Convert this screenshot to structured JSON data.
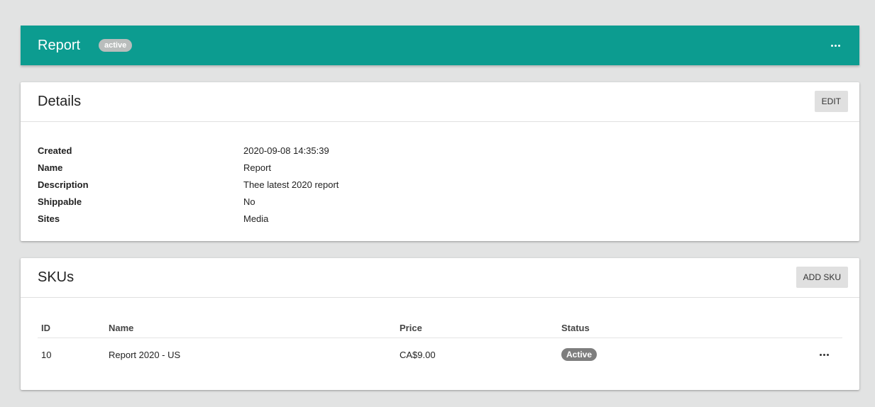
{
  "header": {
    "title": "Report",
    "status": "active",
    "accent_color": "#0c9c90",
    "more_icon": "more-horizontal-icon"
  },
  "details": {
    "title": "Details",
    "edit_label": "EDIT",
    "fields": [
      {
        "label": "Created",
        "value": "2020-09-08 14:35:39"
      },
      {
        "label": "Name",
        "value": "Report"
      },
      {
        "label": "Description",
        "value": "Thee latest 2020 report"
      },
      {
        "label": "Shippable",
        "value": "No"
      },
      {
        "label": "Sites",
        "value": "Media"
      }
    ]
  },
  "skus": {
    "title": "SKUs",
    "add_label": "ADD SKU",
    "columns": [
      "ID",
      "Name",
      "Price",
      "Status"
    ],
    "rows": [
      {
        "id": "10",
        "name": "Report 2020 - US",
        "price": "CA$9.00",
        "status": "Active",
        "more_icon": "more-horizontal-icon"
      }
    ]
  }
}
